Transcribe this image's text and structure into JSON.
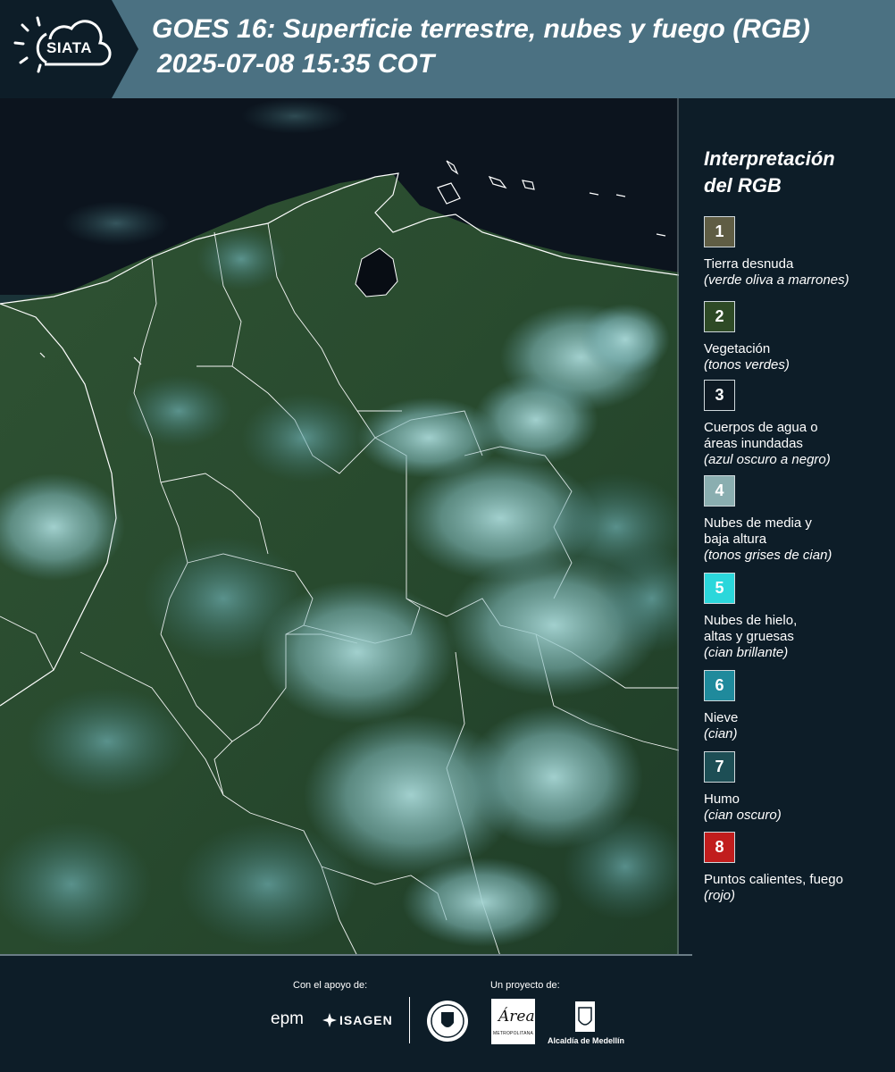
{
  "header": {
    "logo_text": "SIATA",
    "title_line1": "GOES 16: Superficie terrestre, nubes y fuego (RGB)",
    "title_line2": "2025-07-08 15:35 COT"
  },
  "legend": {
    "title": "Interpretación\ndel RGB",
    "items": [
      {
        "num": "1",
        "label": "Tierra desnuda",
        "sub": "(verde oliva a marrones)",
        "color": "#5f5d44"
      },
      {
        "num": "2",
        "label": "Vegetación",
        "sub": "(tonos verdes)",
        "color": "#2e4a26"
      },
      {
        "num": "3",
        "label": "Cuerpos de agua o\náreas inundadas",
        "sub": "(azul oscuro a negro)",
        "color": "#0e1a24"
      },
      {
        "num": "4",
        "label": "Nubes de media y\nbaja altura",
        "sub": "(tonos grises de cian)",
        "color": "#8aaeb0"
      },
      {
        "num": "5",
        "label": "Nubes de hielo,\naltas y gruesas",
        "sub": "(cian brillante)",
        "color": "#2bd7db"
      },
      {
        "num": "6",
        "label": "Nieve",
        "sub": "(cian)",
        "color": "#1f8a9c"
      },
      {
        "num": "7",
        "label": "Humo",
        "sub": "(cian oscuro)",
        "color": "#1d4e55"
      },
      {
        "num": "8",
        "label": "Puntos calientes, fuego",
        "sub": "(rojo)",
        "color": "#c11d1d"
      }
    ]
  },
  "footer": {
    "support_caption": "Con el apoyo de:",
    "project_caption": "Un proyecto de:",
    "sponsors": [
      "epm",
      "ISAGEN"
    ],
    "partners": {
      "area_word": "Área",
      "area_line": "METROPOLITANA",
      "medellin": "Alcaldía de Medellín"
    }
  },
  "colors": {
    "header_bg": "#4b7182",
    "page_bg": "#0d1d28",
    "vegetation": "#2c4a2a",
    "cloud": "#9fd3d3"
  }
}
